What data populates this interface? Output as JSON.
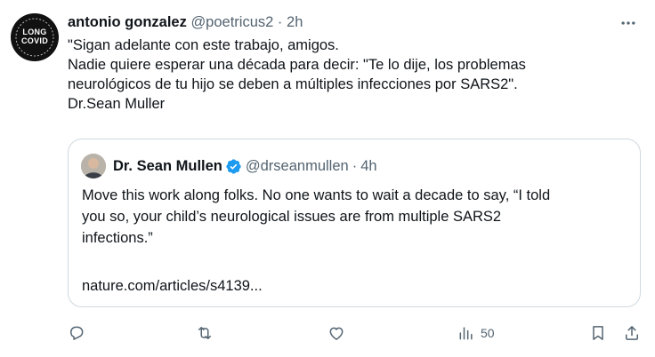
{
  "tweet": {
    "author_name": "antonio gonzalez",
    "handle": "@poetricus2",
    "separator": "·",
    "time": "2h",
    "avatar_text_line1": "LONG",
    "avatar_text_line2": "COVID",
    "text_lines": [
      "\"Sigan adelante con este trabajo, amigos.",
      "Nadie quiere esperar una década para decir: \"Te lo dije, los problemas",
      "neurológicos de tu hijo se deben a múltiples infecciones por SARS2\".",
      "Dr.Sean Muller"
    ]
  },
  "quote": {
    "author_name": "Dr. Sean Mullen",
    "handle": "@drseanmullen",
    "separator": "·",
    "time": "4h",
    "text_lines": [
      "Move this work along folks. No one wants to wait a decade to say, “I told",
      "you so, your child’s neurological issues are from multiple SARS2",
      "infections.”"
    ],
    "link": "nature.com/articles/s4139..."
  },
  "actions": {
    "views_count": "50"
  },
  "colors": {
    "text": "#0f1419",
    "meta": "#536471",
    "border": "#cfd9de",
    "verified": "#1d9bf0"
  }
}
